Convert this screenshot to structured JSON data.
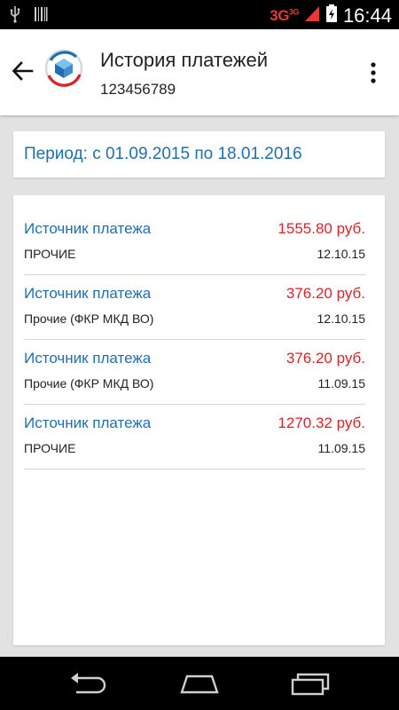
{
  "status_bar": {
    "network": "3G",
    "network_sup": "3G",
    "time": "16:44",
    "icons": [
      "usb-icon",
      "barcode-icon",
      "signal-icon",
      "battery-charging-icon"
    ]
  },
  "app_bar": {
    "title": "История платежей",
    "subtitle": "123456789",
    "icons": [
      "back-arrow-icon",
      "app-logo-icon",
      "more-vert-icon"
    ]
  },
  "period": {
    "text": "Период: с 01.09.2015 по 18.01.2016"
  },
  "payments": [
    {
      "label": "Источник платежа",
      "amount": "1555.80 руб.",
      "category": "ПРОЧИЕ",
      "date": "12.10.15"
    },
    {
      "label": "Источник платежа",
      "amount": "376.20 руб.",
      "category": "Прочие (ФКР МКД ВО)",
      "date": "12.10.15"
    },
    {
      "label": "Источник платежа",
      "amount": "376.20 руб.",
      "category": "Прочие (ФКР МКД ВО)",
      "date": "11.09.15"
    },
    {
      "label": "Источник платежа",
      "amount": "1270.32 руб.",
      "category": "ПРОЧИЕ",
      "date": "11.09.15"
    }
  ],
  "nav_bar": {
    "icons": [
      "back-nav-icon",
      "home-nav-icon",
      "recents-nav-icon"
    ]
  },
  "colors": {
    "accent_blue": "#1e6fb0",
    "amount_red": "#d8232a",
    "background": "#e2e2e2"
  }
}
